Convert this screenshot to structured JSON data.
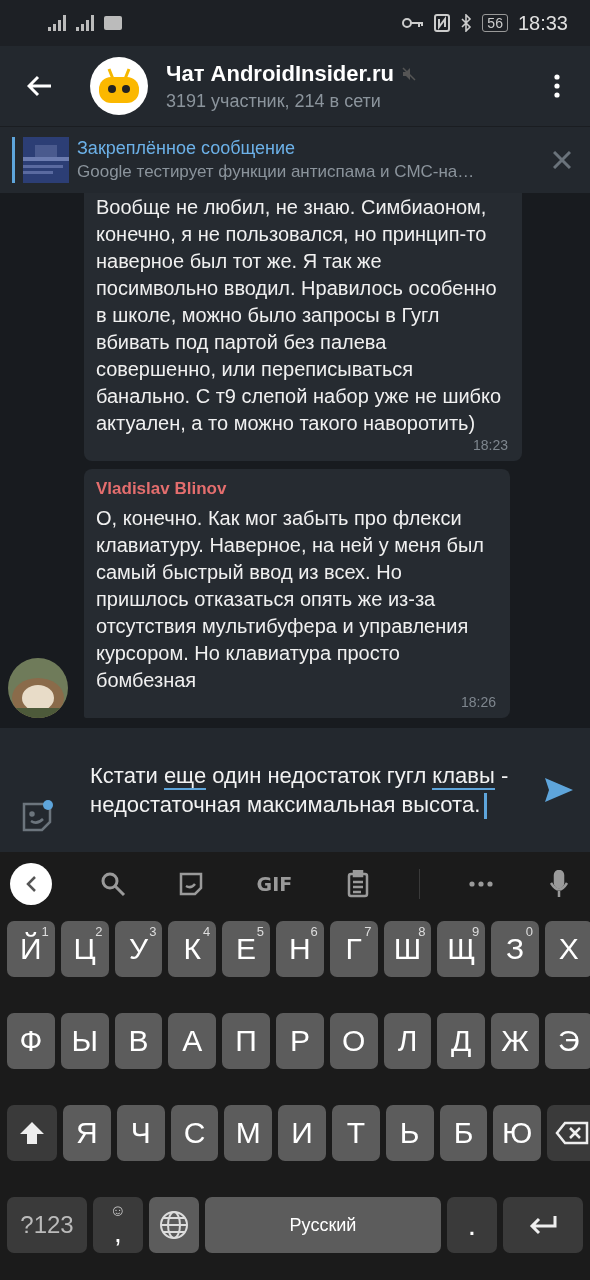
{
  "status_bar": {
    "time": "18:33",
    "battery": "56"
  },
  "header": {
    "title": "Чат AndroidInsider.ru",
    "subtitle": "3191 участник, 214 в сети",
    "muted": true
  },
  "pinned": {
    "title": "Закреплённое сообщение",
    "text": "Google тестирует функции антиспама и СМС-на…"
  },
  "messages": [
    {
      "text": "Вообще не любил, не знаю. Симбиаоном, конечно, я не пользовался, но принцип-то наверное был тот же. Я так же посимвольно вводил. Нравилось особенно в школе, можно было запросы в Гугл вбивать под партой без палева совершенно, или переписываться банально. С т9 слепой набор уже не шибко актуален, а то можно такого наворотить)",
      "time": "18:23",
      "avatar": false
    },
    {
      "sender": "Vladislav Blinov",
      "text": "О, конечно. Как мог забыть про флекси клавиатуру. Наверное, на ней у меня был самый быстрый ввод из всех. Но пришлось отказаться опять же из-за отсутствия мультибуфера и управления курсором. Но клавиатура просто бомбезная",
      "time": "18:26",
      "avatar": true
    }
  ],
  "input": {
    "segments": [
      {
        "text": "Кстати ",
        "underlined": false
      },
      {
        "text": "еще",
        "underlined": true
      },
      {
        "text": " один недостаток гугл ",
        "underlined": false
      },
      {
        "text": "клавы",
        "underlined": true
      },
      {
        "text": " - недостаточная максимальная высота.",
        "underlined": false
      }
    ]
  },
  "keyboard_toolbar": {
    "gif": "GIF"
  },
  "keyboard": {
    "rows": [
      {
        "keys": [
          {
            "kind": "letter",
            "label": "Й",
            "hint": "1"
          },
          {
            "kind": "letter",
            "label": "Ц",
            "hint": "2"
          },
          {
            "kind": "letter",
            "label": "У",
            "hint": "3"
          },
          {
            "kind": "letter",
            "label": "К",
            "hint": "4"
          },
          {
            "kind": "letter",
            "label": "Е",
            "hint": "5"
          },
          {
            "kind": "letter",
            "label": "Н",
            "hint": "6"
          },
          {
            "kind": "letter",
            "label": "Г",
            "hint": "7"
          },
          {
            "kind": "letter",
            "label": "Ш",
            "hint": "8"
          },
          {
            "kind": "letter",
            "label": "Щ",
            "hint": "9"
          },
          {
            "kind": "letter",
            "label": "З",
            "hint": "0"
          },
          {
            "kind": "letter",
            "label": "Х"
          }
        ]
      },
      {
        "keys": [
          {
            "kind": "letter",
            "label": "Ф"
          },
          {
            "kind": "letter",
            "label": "Ы"
          },
          {
            "kind": "letter",
            "label": "В"
          },
          {
            "kind": "letter",
            "label": "А"
          },
          {
            "kind": "letter",
            "label": "П"
          },
          {
            "kind": "letter",
            "label": "Р"
          },
          {
            "kind": "letter",
            "label": "О"
          },
          {
            "kind": "letter",
            "label": "Л"
          },
          {
            "kind": "letter",
            "label": "Д"
          },
          {
            "kind": "letter",
            "label": "Ж"
          },
          {
            "kind": "letter",
            "label": "Э"
          }
        ]
      },
      {
        "keys": [
          {
            "kind": "shift"
          },
          {
            "kind": "letter",
            "label": "Я"
          },
          {
            "kind": "letter",
            "label": "Ч"
          },
          {
            "kind": "letter",
            "label": "С"
          },
          {
            "kind": "letter",
            "label": "М"
          },
          {
            "kind": "letter",
            "label": "И"
          },
          {
            "kind": "letter",
            "label": "Т"
          },
          {
            "kind": "letter",
            "label": "Ь"
          },
          {
            "kind": "letter",
            "label": "Б"
          },
          {
            "kind": "letter",
            "label": "Ю"
          },
          {
            "kind": "backspace"
          }
        ]
      },
      {
        "keys": [
          {
            "kind": "symbols",
            "label": "?123"
          },
          {
            "kind": "comma",
            "label": ",",
            "hint": "☺"
          },
          {
            "kind": "globe"
          },
          {
            "kind": "space",
            "label": "Русский"
          },
          {
            "kind": "period",
            "label": "."
          },
          {
            "kind": "enter"
          }
        ]
      }
    ]
  }
}
